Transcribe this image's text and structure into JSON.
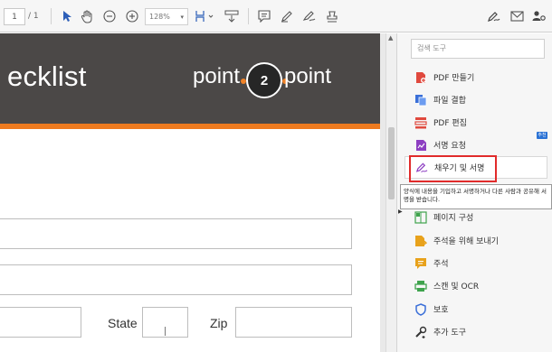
{
  "toolbar": {
    "page_current": "1",
    "page_total": "/ 1",
    "zoom": "128%",
    "icons": [
      "select-arrow-icon",
      "hand-tool-icon",
      "zoom-out-icon",
      "zoom-in-icon",
      "fit-page-icon",
      "scroll-mode-icon",
      "comment-icon",
      "pen-icon",
      "sign-icon",
      "stamp-icon",
      "fill-sign-icon",
      "email-icon",
      "share-user-icon"
    ]
  },
  "document": {
    "banner_title": "ecklist",
    "logo_left": "point",
    "logo_number": "2",
    "logo_right": "point",
    "state_label": "State",
    "zip_label": "Zip",
    "colors": {
      "banner": "#4b4847",
      "accent": "#ed7a1f"
    }
  },
  "right_pane": {
    "search_placeholder": "검색 도구",
    "tools": [
      {
        "label": "PDF 만들기",
        "icon": "create-pdf-icon",
        "color": "#e0493e"
      },
      {
        "label": "파일 결합",
        "icon": "combine-files-icon",
        "color": "#3a6fd8"
      },
      {
        "label": "PDF 편집",
        "icon": "edit-pdf-icon",
        "color": "#e0493e"
      },
      {
        "label": "서명 요청",
        "icon": "request-signature-icon",
        "color": "#8d3fc2"
      },
      {
        "label": "채우기 및 서명",
        "icon": "fill-sign-icon",
        "color": "#8d3fc2"
      },
      {
        "label": "페이지 구성",
        "icon": "organize-pages-icon",
        "color": "#3fa34d"
      },
      {
        "label": "주석을 위해 보내기",
        "icon": "send-comments-icon",
        "color": "#e8a21c"
      },
      {
        "label": "주석",
        "icon": "comment-icon",
        "color": "#e8a21c"
      },
      {
        "label": "스캔 및 OCR",
        "icon": "scan-ocr-icon",
        "color": "#3fa34d"
      },
      {
        "label": "보호",
        "icon": "protect-icon",
        "color": "#3a6fd8"
      },
      {
        "label": "추가 도구",
        "icon": "more-tools-icon",
        "color": "#333333"
      }
    ],
    "badge": "추천",
    "tooltip": "양식에 내용을 기입하고 서명하거나 다른 사람과 공유해 서명을 받습니다."
  }
}
